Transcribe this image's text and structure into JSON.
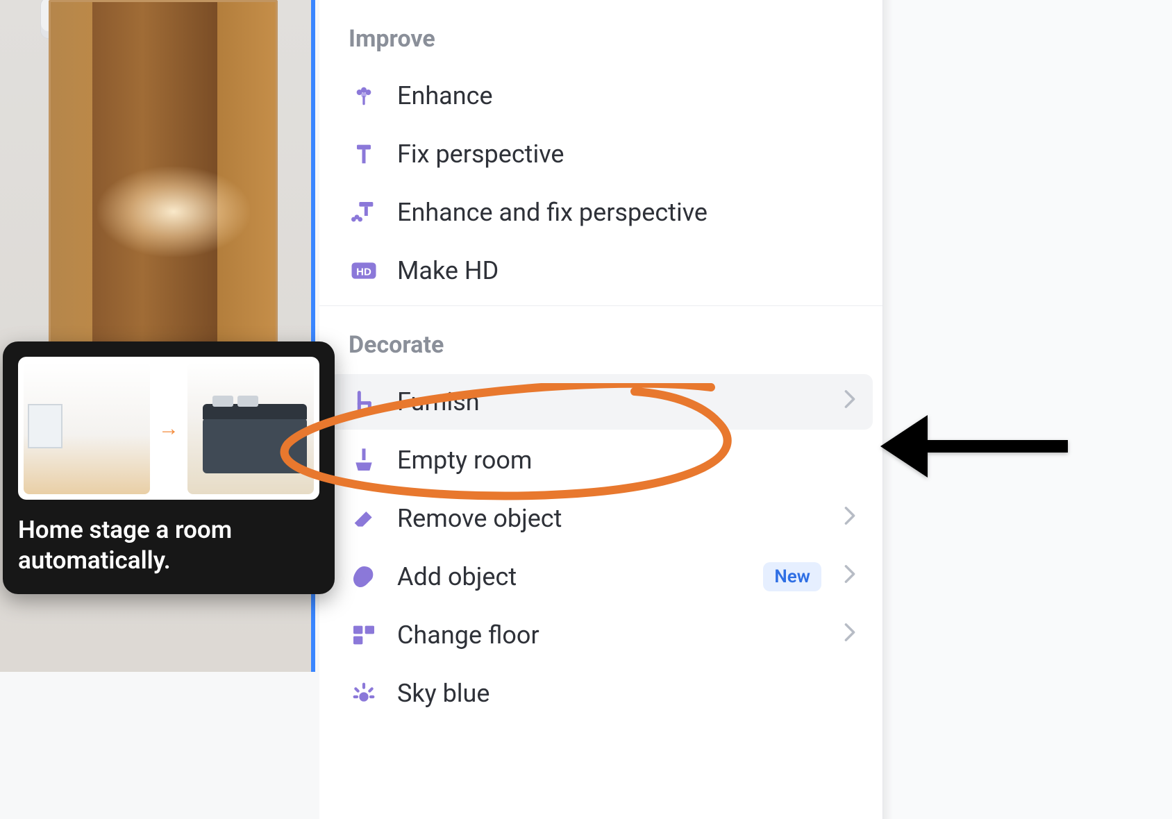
{
  "tooltip": {
    "caption": "Home stage a room automatically."
  },
  "sections": {
    "improve": {
      "header": "Improve",
      "items": {
        "enhance": "Enhance",
        "fix_perspective": "Fix perspective",
        "enhance_fix": "Enhance and fix perspective",
        "make_hd": "Make HD"
      }
    },
    "decorate": {
      "header": "Decorate",
      "items": {
        "furnish": "Furnish",
        "empty_room": "Empty room",
        "remove_object": "Remove object",
        "add_object": "Add object",
        "change_floor": "Change floor",
        "sky_blue": "Sky blue"
      },
      "add_object_badge": "New"
    }
  },
  "colors": {
    "accent": "#8b78d9",
    "annotation": "#e8782e",
    "badge_bg": "#e6efff",
    "badge_text": "#2f6fe4"
  }
}
